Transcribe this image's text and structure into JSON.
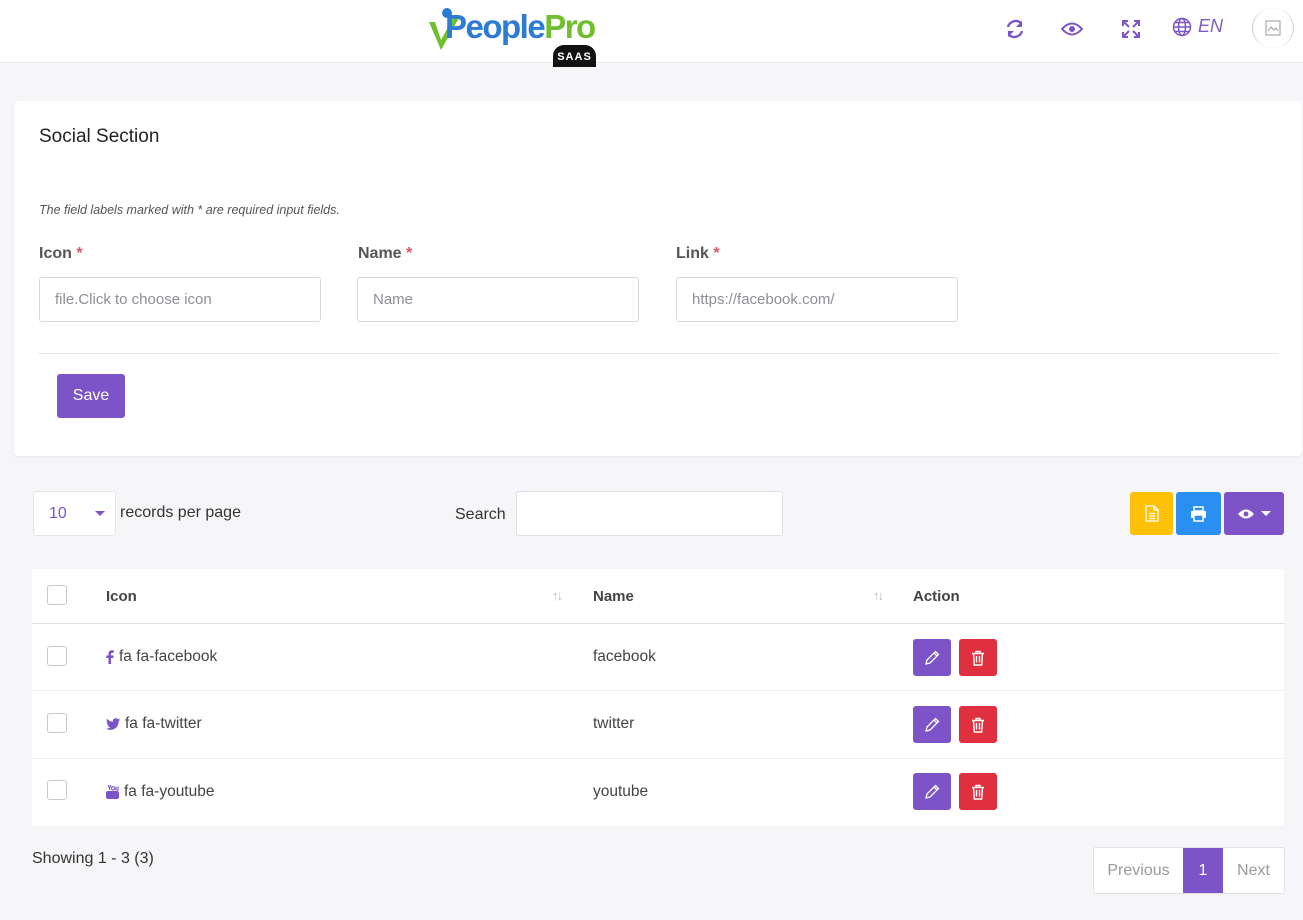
{
  "header": {
    "logo_text_1": "People",
    "logo_text_2": "Pro",
    "logo_badge": "SAAS",
    "language": "EN",
    "icons": [
      "refresh-icon",
      "eye-icon",
      "fullscreen-icon",
      "globe-icon",
      "avatar"
    ]
  },
  "form": {
    "title": "Social Section",
    "note": "The field labels marked with * are required input fields.",
    "required_mark": "*",
    "icon_label": "Icon",
    "icon_placeholder": "file.Click to choose icon",
    "name_label": "Name",
    "name_placeholder": "Name",
    "link_label": "Link",
    "link_placeholder": "https://facebook.com/",
    "save_label": "Save"
  },
  "controls": {
    "per_page_value": "10",
    "per_page_label": "records per page",
    "search_label": "Search"
  },
  "table": {
    "columns": [
      "Icon",
      "Name",
      "Action"
    ],
    "rows": [
      {
        "icon": "fa fa-facebook",
        "name": "facebook",
        "icon_glyph": "facebook-icon"
      },
      {
        "icon": "fa fa-twitter",
        "name": "twitter",
        "icon_glyph": "twitter-icon"
      },
      {
        "icon": "fa fa-youtube",
        "name": "youtube",
        "icon_glyph": "youtube-icon"
      }
    ]
  },
  "footer": {
    "showing": "Showing 1 - 3 (3)",
    "previous": "Previous",
    "page": "1",
    "next": "Next"
  },
  "colors": {
    "primary": "#7c54c8",
    "warning": "#ffc107",
    "info": "#2a8ff0",
    "danger": "#e0303f"
  }
}
